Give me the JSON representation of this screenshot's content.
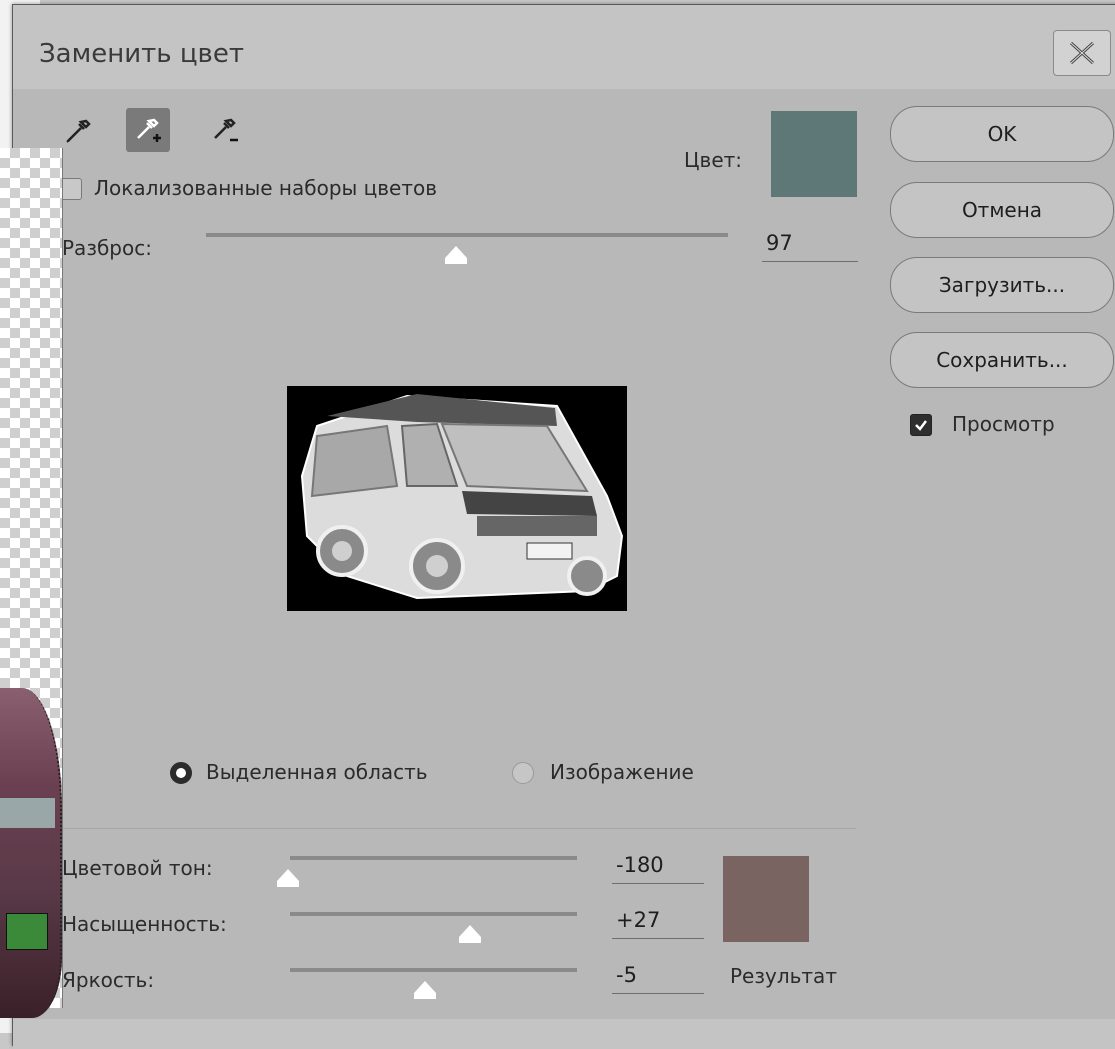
{
  "dialog": {
    "title": "Заменить цвет",
    "close_icon": "close-x-icon"
  },
  "tools": {
    "eyedropper": "eyedropper-icon",
    "eyedropper_add": "eyedropper-plus-icon",
    "eyedropper_subtract": "eyedropper-minus-icon",
    "active": "eyedropper_add"
  },
  "selection": {
    "localized_label": "Локализованные наборы цветов",
    "localized_checked": false,
    "color_label": "Цвет:",
    "color_swatch": "#5e7878",
    "fuzziness_label": "Разброс:",
    "fuzziness_value": "97",
    "fuzziness_level": 0.46
  },
  "preview_mode": {
    "selection_label": "Выделенная область",
    "image_label": "Изображение",
    "selected": "selection"
  },
  "replacement": {
    "hue_label": "Цветовой тон:",
    "hue_value": "-180",
    "hue_level": 0.0,
    "saturation_label": "Насыщенность:",
    "saturation_value": "+27",
    "saturation_level": 0.63,
    "lightness_label": "Яркость:",
    "lightness_value": "-5",
    "lightness_level": 0.47,
    "result_label": "Результат",
    "result_swatch": "#7a6462"
  },
  "buttons": {
    "ok": "OK",
    "cancel": "Отмена",
    "load": "Загрузить...",
    "save": "Сохранить..."
  },
  "preview_checkbox": {
    "label": "Просмотр",
    "checked": true
  }
}
